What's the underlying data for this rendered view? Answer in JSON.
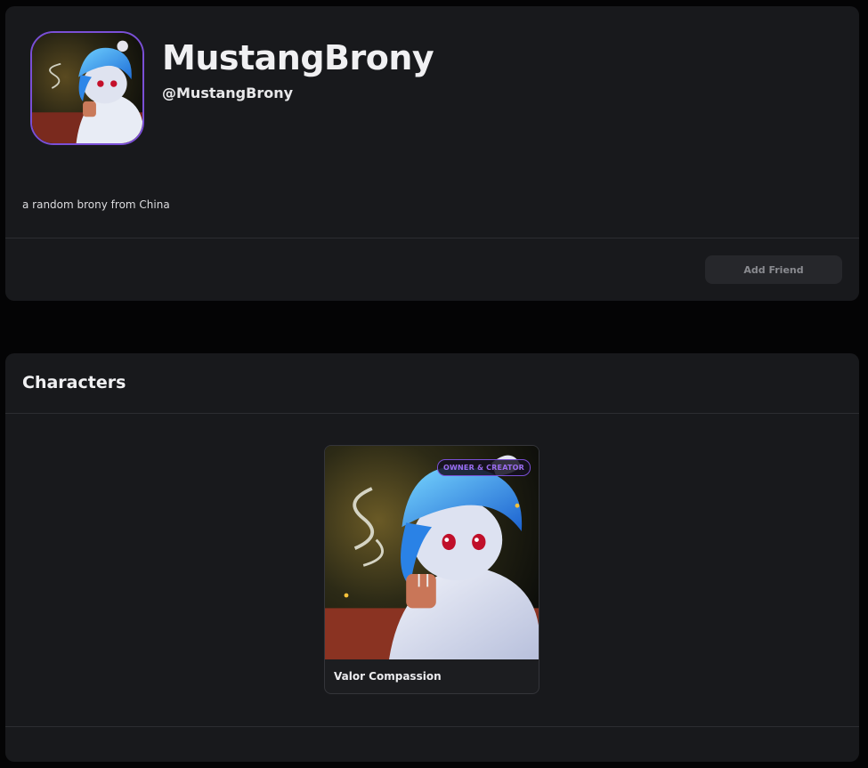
{
  "profile": {
    "display_name": "MustangBrony",
    "handle": "@MustangBrony",
    "bio": "a random brony from China",
    "add_friend_label": "Add Friend",
    "avatar_icon": "pony-avatar-icon"
  },
  "characters": {
    "title": "Characters",
    "items": [
      {
        "name": "Valor Compassion",
        "badge": "OWNER & CREATOR"
      }
    ]
  },
  "colors": {
    "background": "#040405",
    "card": "#18191c",
    "accent": "#7a4fd6",
    "badge_text": "#9b6cf0",
    "muted_button": "#26272b"
  }
}
